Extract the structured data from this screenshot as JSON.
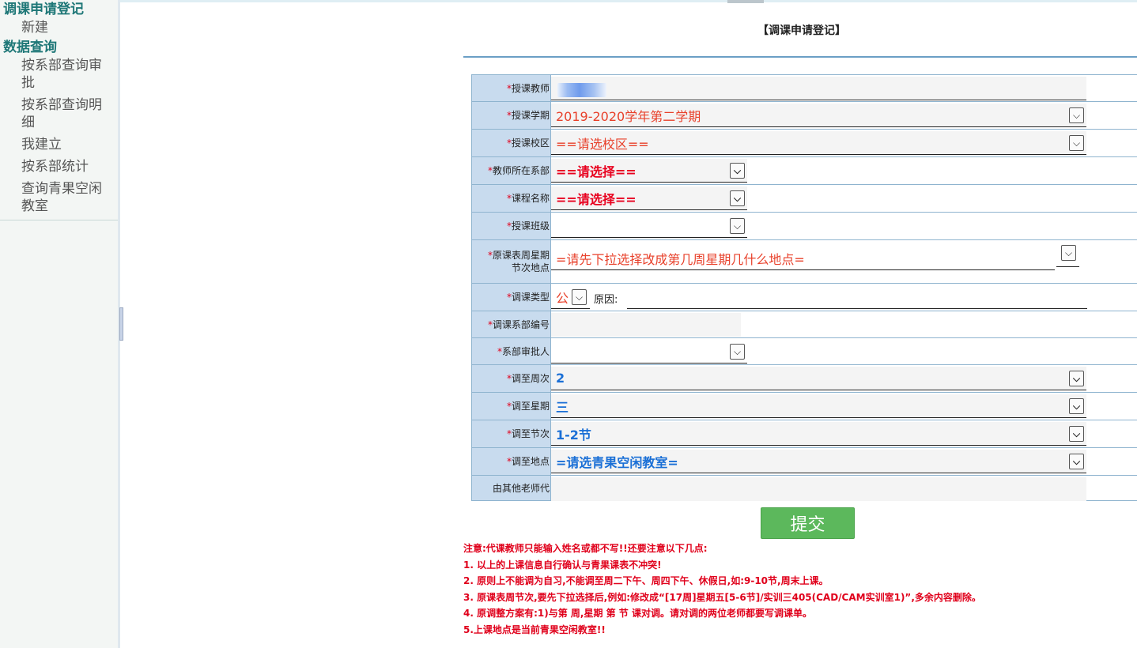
{
  "sidebar": {
    "group1": "调课申请登记",
    "group1_items": [
      "新建"
    ],
    "group2": "数据查询",
    "group2_items": [
      "按系部查询审批",
      "按系部查询明细",
      "我建立",
      "按系部统计",
      "查询青果空闲教室"
    ]
  },
  "page": {
    "title": "【调课申请登记】"
  },
  "form": {
    "required_mark": "*",
    "teacher": {
      "label": "授课教师",
      "value": ""
    },
    "term": {
      "label": "授课学期",
      "value": "2019-2020学年第二学期"
    },
    "campus": {
      "label": "授课校区",
      "value": "==请选校区=="
    },
    "dept": {
      "label": "教师所在系部",
      "value": "==请选择=="
    },
    "course": {
      "label": "课程名称",
      "value": "==请选择=="
    },
    "class": {
      "label": "授课班级",
      "value": ""
    },
    "original": {
      "label_line1": "原课表周星期",
      "label_line2": "节次地点",
      "value": "=请先下拉选择改成第几周星期几什么地点="
    },
    "adjust_type": {
      "label": "调课类型",
      "value": "公",
      "reason_label": "原因:",
      "reason_value": ""
    },
    "dept_code": {
      "label": "调课系部编号",
      "value": ""
    },
    "approver": {
      "label": "系部审批人",
      "value": ""
    },
    "to_week": {
      "label": "调至周次",
      "value": "2"
    },
    "to_weekday": {
      "label": "调至星期",
      "value": "三"
    },
    "to_period": {
      "label": "调至节次",
      "value": "1-2节"
    },
    "to_location": {
      "label": "调至地点",
      "value": "=请选青果空闲教室="
    },
    "substitute": {
      "label": "由其他老师代",
      "value": ""
    }
  },
  "submit_label": "提交",
  "notes": [
    "注意:代课教师只能输入姓名或都不写!!还要注意以下几点:",
    "1. 以上的上课信息自行确认与青果课表不冲突!",
    "2. 原则上不能调为自习,不能调至周二下午、周四下午、休假日,如:9-10节,周末上课。",
    "3. 原课表周节次,要先下拉选择后,例如:修改成“[17周]星期五[5-6节]/实训三405(CAD/CAM实训室1)”,多余内容删除。",
    "4. 原调整方案有:1)与第 周,星期 第 节 课对调。请对调的两位老师都要写调课单。",
    "5.上课地点是当前青果空闲教室!!"
  ],
  "colors": {
    "accent": "#1e7777",
    "label_bg": "#c8dbee",
    "button": "#5cb85c",
    "warning": "#e0001b"
  }
}
